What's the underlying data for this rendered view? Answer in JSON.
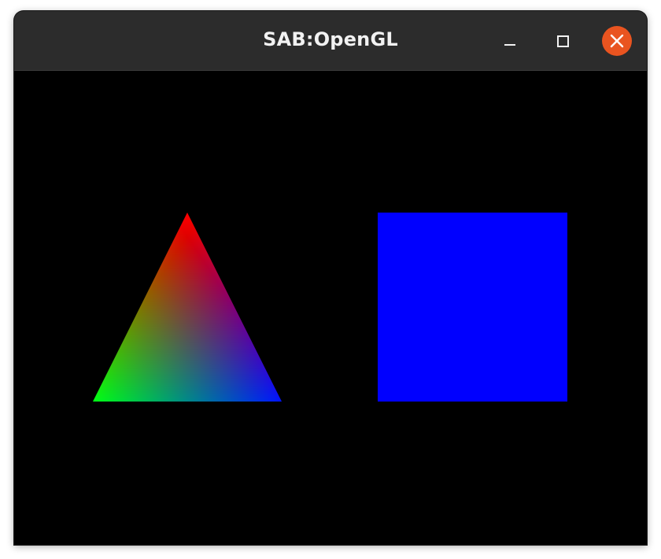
{
  "window": {
    "title": "SAB:OpenGL"
  },
  "titlebar_buttons": [
    {
      "name": "minimize",
      "icon": "minimize-icon"
    },
    {
      "name": "maximize",
      "icon": "maximize-icon"
    },
    {
      "name": "close",
      "icon": "close-icon"
    }
  ],
  "colors": {
    "titlebar": "#2c2c2c",
    "canvas_background": "#000000",
    "close_button": "#e95420",
    "square_fill": "#0000ff",
    "triangle_vertex_top": "#ff0000",
    "triangle_vertex_left": "#00ff00",
    "triangle_vertex_right": "#0000ff"
  },
  "scene": {
    "shapes": [
      "triangle",
      "square"
    ]
  }
}
